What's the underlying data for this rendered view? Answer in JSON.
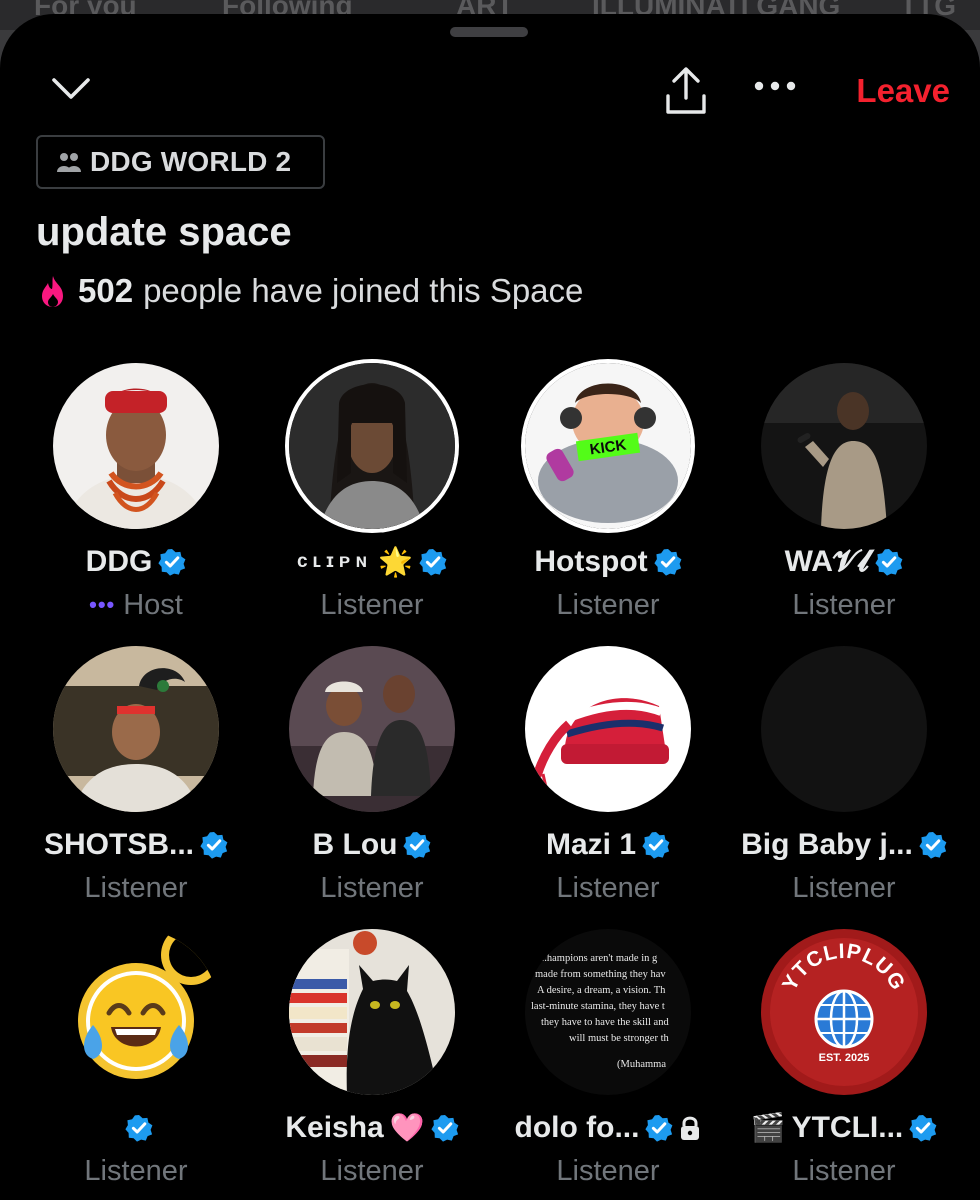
{
  "background_tabs": [
    "For you",
    "Following",
    "ART",
    "ILLUMINATI GANG",
    "TTG"
  ],
  "header": {
    "close_icon": "chevron-down-icon",
    "share_icon": "share-icon",
    "more_icon": "more-icon",
    "leave_label": "Leave",
    "leave_color": "#f4212e"
  },
  "community": {
    "name": "DDG WORLD 2",
    "icon": "community-icon"
  },
  "space": {
    "title": "update space",
    "joined_count": "502",
    "joined_text": "people have joined this Space",
    "joined_icon": "fire-icon"
  },
  "participants": [
    {
      "name": "DDG",
      "role": "Host",
      "verified": true
    },
    {
      "name": "ᴄʟɪᴘɴ",
      "name_emoji": "🌟",
      "role": "Listener",
      "verified": true
    },
    {
      "name": "Hotspot",
      "role": "Listener",
      "verified": true
    },
    {
      "name": "WA𝓥𝓵",
      "role": "Listener",
      "verified": true
    },
    {
      "name": "SHOTSB...",
      "role": "Listener",
      "verified": true
    },
    {
      "name": "B Lou",
      "role": "Listener",
      "verified": true
    },
    {
      "name": "Mazi 1",
      "role": "Listener",
      "verified": true
    },
    {
      "name": "Big Baby j...",
      "role": "Listener",
      "verified": true
    },
    {
      "name": "",
      "role": "Listener",
      "verified": true
    },
    {
      "name": "Keisha",
      "name_emoji": "🩷",
      "role": "Listener",
      "verified": true
    },
    {
      "name": "dolo fo...",
      "role": "Listener",
      "verified": true,
      "locked": true
    },
    {
      "name": "YTCLI...",
      "name_prefix_emoji": "🎬",
      "role": "Listener",
      "verified": true
    }
  ],
  "avatar_text": {
    "kick_sticker": "KICK",
    "quote_lines": [
      "...hampions aren't made in g",
      "made from something they hav",
      "A desire, a dream, a vision. Th",
      "last-minute stamina, they have t",
      "they have to have the skill and",
      "will must be stronger th",
      "(Muhamma"
    ],
    "ytcliplug_logo": "YTCLIPLUG",
    "ytcliplug_est": "EST. 2025"
  },
  "colors": {
    "verified_badge": "#1d9bf0",
    "host_dots": "#7856ff",
    "fire": "#f91880",
    "muted_text": "#71767b"
  }
}
